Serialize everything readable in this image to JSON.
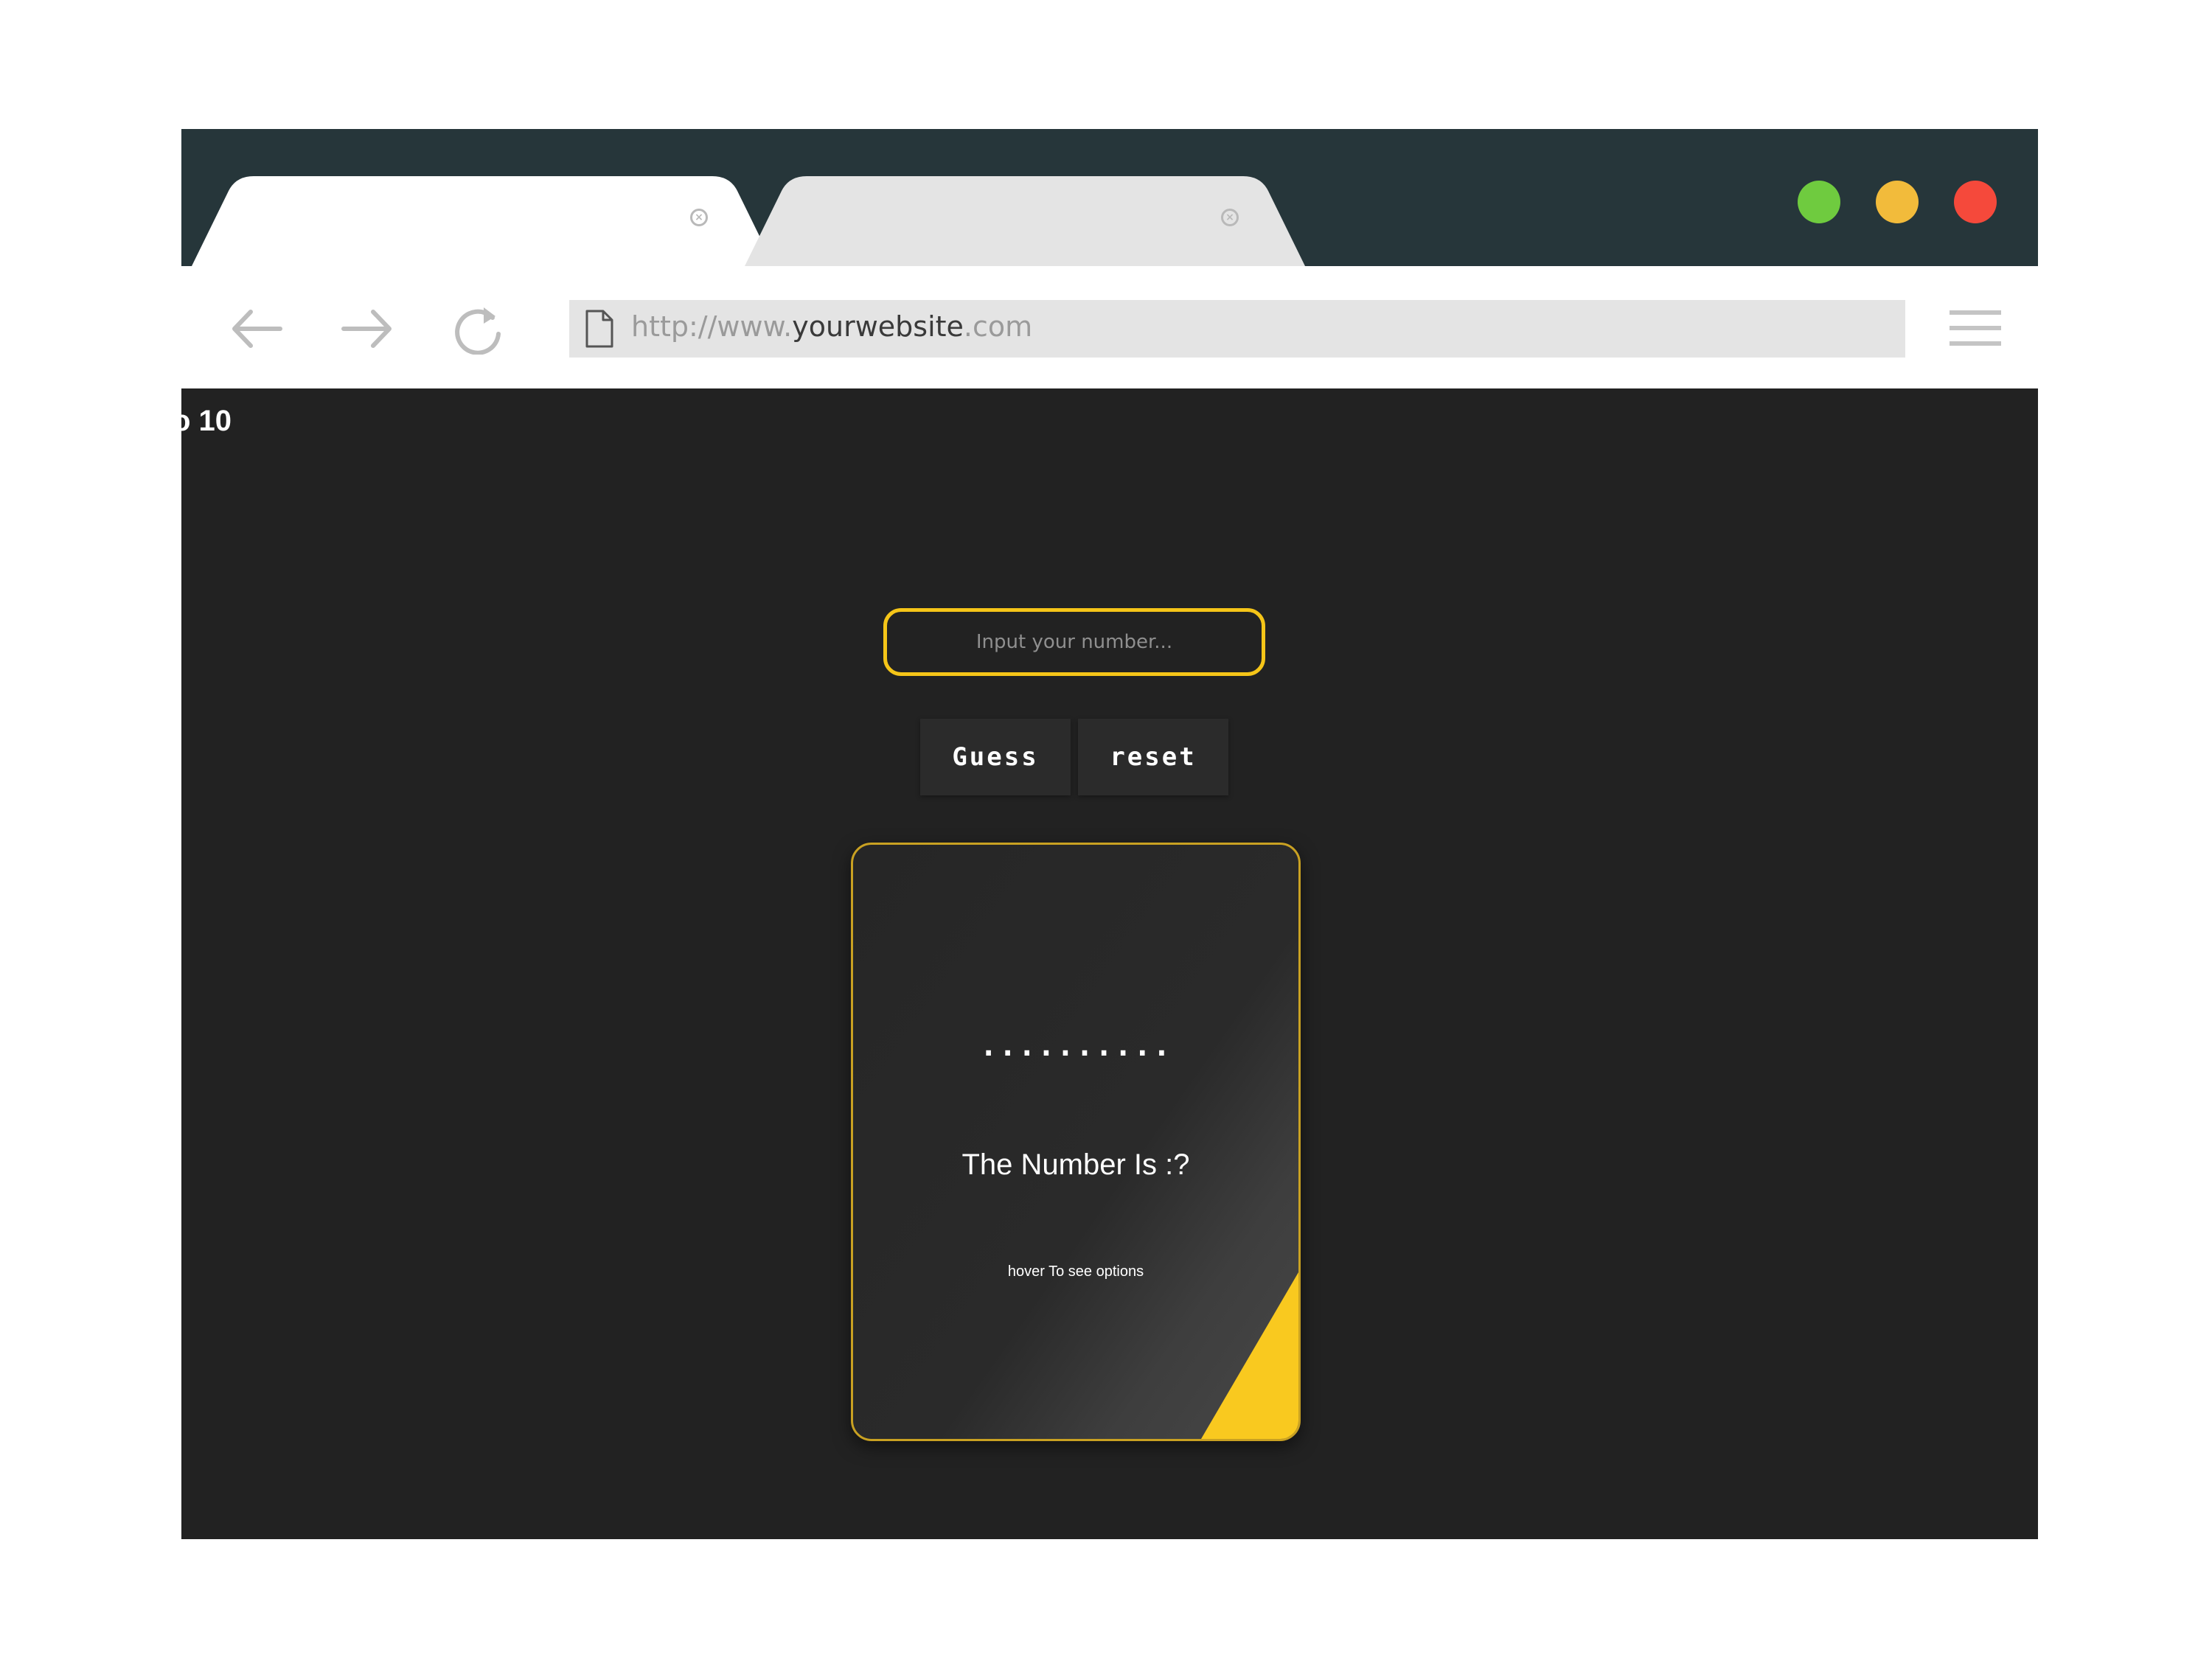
{
  "browser": {
    "tabs": [
      {
        "title": "",
        "active": true
      },
      {
        "title": "",
        "active": false
      }
    ],
    "window_buttons": {
      "maximize_color": "#6fcb3f",
      "minimize_color": "#f2bb3b",
      "close_color": "#f5493b"
    },
    "address": {
      "scheme": "http://www.",
      "host": "yourwebsite",
      "tld": ".com"
    }
  },
  "page": {
    "heading": "o 10",
    "input_placeholder": "Input your number...",
    "guess_label": "Guess",
    "reset_label": "reset",
    "card": {
      "dots": "..........",
      "title": "The Number Is :?",
      "hint": "hover To see options"
    }
  },
  "colors": {
    "accent": "#f5c518",
    "page_background": "#222222",
    "titlebar": "#26363a"
  }
}
